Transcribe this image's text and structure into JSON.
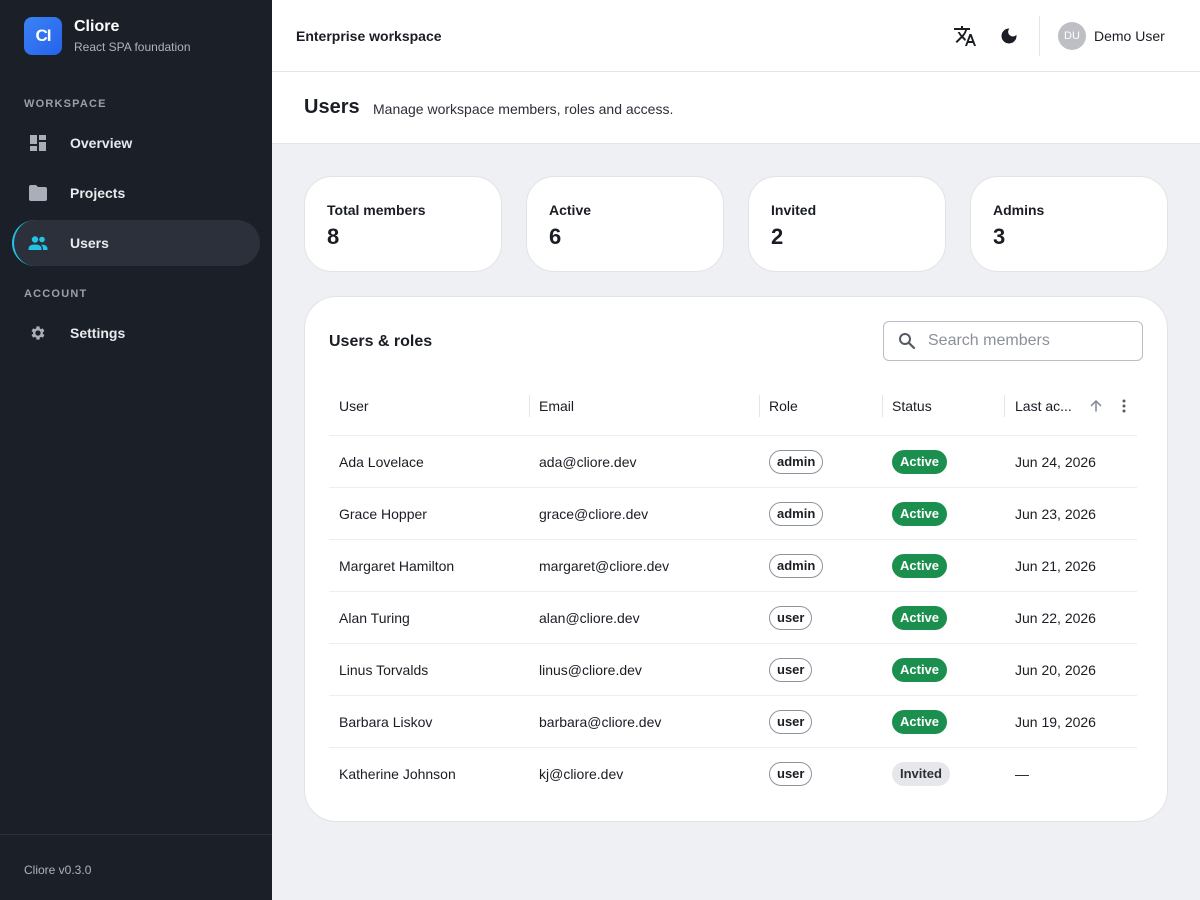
{
  "brand": {
    "logo_text": "CI",
    "name": "Cliore",
    "subtitle": "React SPA foundation"
  },
  "sidebar": {
    "sections": [
      {
        "label": "WORKSPACE",
        "items": [
          {
            "label": "Overview",
            "icon": "dashboard-icon"
          },
          {
            "label": "Projects",
            "icon": "folder-icon"
          },
          {
            "label": "Users",
            "icon": "users-icon",
            "active": true
          }
        ]
      },
      {
        "label": "ACCOUNT",
        "items": [
          {
            "label": "Settings",
            "icon": "gear-icon"
          }
        ]
      }
    ],
    "version": "Cliore v0.3.0"
  },
  "topbar": {
    "workspace": "Enterprise workspace",
    "icons": [
      "translate-icon",
      "dark-mode-icon"
    ],
    "user": {
      "initials": "DU",
      "name": "Demo User"
    }
  },
  "header": {
    "title": "Users",
    "subtitle": "Manage workspace members, roles and access."
  },
  "stats": [
    {
      "label": "Total members",
      "value": "8"
    },
    {
      "label": "Active",
      "value": "6"
    },
    {
      "label": "Invited",
      "value": "2"
    },
    {
      "label": "Admins",
      "value": "3"
    }
  ],
  "table": {
    "title": "Users & roles",
    "search_placeholder": "Search members",
    "columns": [
      "User",
      "Email",
      "Role",
      "Status",
      "Last ac..."
    ],
    "rows": [
      {
        "user": "Ada Lovelace",
        "email": "ada@cliore.dev",
        "role": "admin",
        "status": "Active",
        "last_active": "Jun 24, 2026"
      },
      {
        "user": "Grace Hopper",
        "email": "grace@cliore.dev",
        "role": "admin",
        "status": "Active",
        "last_active": "Jun 23, 2026"
      },
      {
        "user": "Margaret Hamilton",
        "email": "margaret@cliore.dev",
        "role": "admin",
        "status": "Active",
        "last_active": "Jun 21, 2026"
      },
      {
        "user": "Alan Turing",
        "email": "alan@cliore.dev",
        "role": "user",
        "status": "Active",
        "last_active": "Jun 22, 2026"
      },
      {
        "user": "Linus Torvalds",
        "email": "linus@cliore.dev",
        "role": "user",
        "status": "Active",
        "last_active": "Jun 20, 2026"
      },
      {
        "user": "Barbara Liskov",
        "email": "barbara@cliore.dev",
        "role": "user",
        "status": "Active",
        "last_active": "Jun 19, 2026"
      },
      {
        "user": "Katherine Johnson",
        "email": "kj@cliore.dev",
        "role": "user",
        "status": "Invited",
        "last_active": "—"
      }
    ]
  },
  "colors": {
    "sidebar_bg": "#1b1f27",
    "accent": "#22c3e6",
    "brand": "#2563eb",
    "active_status": "#1b8f4d"
  }
}
